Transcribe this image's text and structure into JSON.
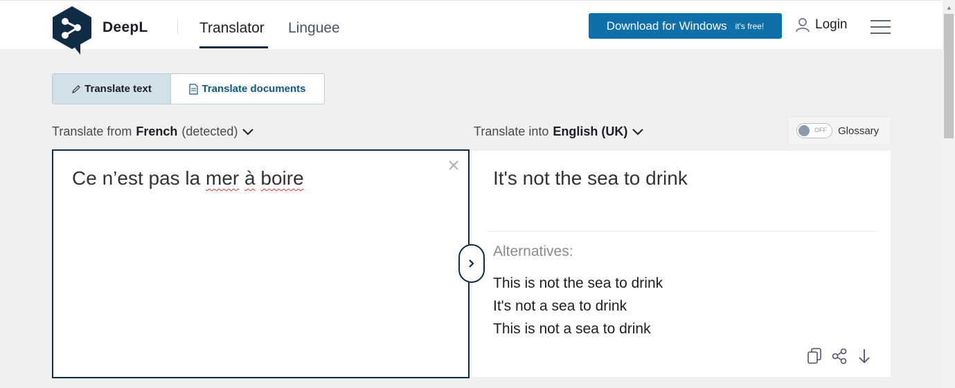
{
  "header": {
    "brand": "DeepL",
    "tabs": [
      {
        "label": "Translator",
        "active": true
      },
      {
        "label": "Linguee",
        "active": false
      }
    ],
    "download": {
      "label": "Download for Windows",
      "sub": "it's free!"
    },
    "login": "Login"
  },
  "modes": {
    "text": "Translate text",
    "documents": "Translate documents"
  },
  "source": {
    "prefix": "Translate from",
    "language": "French",
    "suffix": "(detected)",
    "text_before": "Ce n’est pas la ",
    "misspelled": [
      "mer",
      "à",
      "boire"
    ]
  },
  "target": {
    "prefix": "Translate into",
    "language": "English (UK)",
    "text": "It's not the sea to drink",
    "alternatives_label": "Alternatives:",
    "alternatives": [
      "This is not the sea to drink",
      "It's not a sea to drink",
      "This is not a sea to drink"
    ]
  },
  "glossary": {
    "toggle": "OFF",
    "label": "Glossary"
  },
  "colors": {
    "accent": "#0f6fa8",
    "navy": "#0f2b46",
    "page_bg": "#f0f0f0",
    "active_mode_bg": "#d2e0ea"
  },
  "icons": [
    "deepl-logo-icon",
    "user-icon",
    "menu-icon",
    "pencil-icon",
    "document-icon",
    "chevron-down-icon",
    "close-icon",
    "chevron-right-icon",
    "copy-icon",
    "share-icon",
    "download-arrow-icon"
  ]
}
